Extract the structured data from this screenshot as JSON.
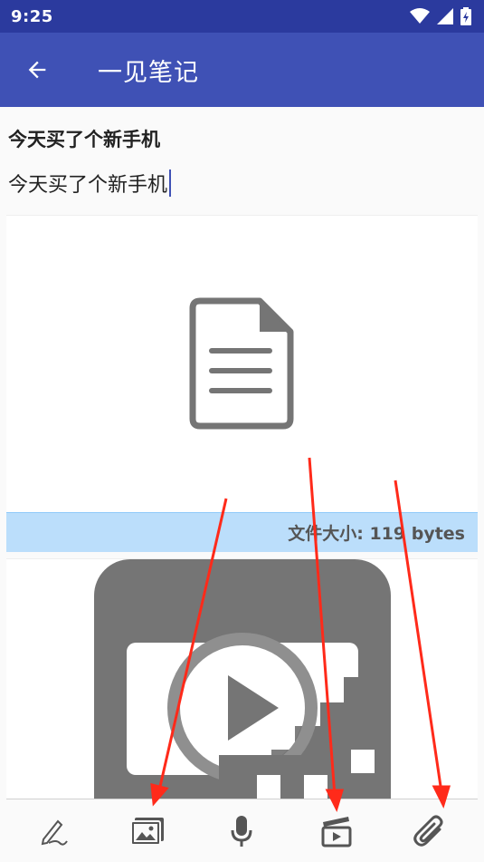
{
  "status_bar": {
    "time": "9:25"
  },
  "app_bar": {
    "title": "一见笔记"
  },
  "note": {
    "title": "今天买了个新手机",
    "body": "今天买了个新手机"
  },
  "attachments": {
    "file": {
      "size_text": "文件大小: 119 bytes"
    },
    "video": {}
  },
  "toolbar": {
    "items": [
      "pen-icon",
      "image-icon",
      "mic-icon",
      "video-icon",
      "attach-icon"
    ]
  },
  "colors": {
    "status_bar": "#2b3a9e",
    "app_bar": "#3f51b5",
    "file_size_bar": "#bbdefb",
    "annotation_arrow": "#ff2a1a"
  }
}
